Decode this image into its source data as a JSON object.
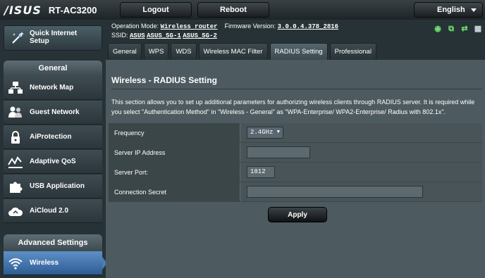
{
  "header": {
    "brand": "/ISUS",
    "model": "RT-AC3200",
    "logout_label": "Logout",
    "reboot_label": "Reboot",
    "language": "English"
  },
  "info": {
    "opmode_label": "Operation Mode:",
    "opmode_value": "Wireless router",
    "firmware_label": "Firmware Version:",
    "firmware_value": "3.0.0.4.378_2816",
    "ssid_label": "SSID:",
    "ssids": [
      "ASUS",
      "ASUS_5G-1",
      "ASUS_5G-2"
    ]
  },
  "sidebar": {
    "qis_label_line1": "Quick Internet",
    "qis_label_line2": "Setup",
    "general_title": "General",
    "general_items": [
      {
        "label": "Network Map",
        "icon": "network-map-icon"
      },
      {
        "label": "Guest Network",
        "icon": "guest-network-icon"
      },
      {
        "label": "AiProtection",
        "icon": "lock-icon"
      },
      {
        "label": "Adaptive QoS",
        "icon": "qos-icon"
      },
      {
        "label": "USB Application",
        "icon": "puzzle-icon"
      },
      {
        "label": "AiCloud 2.0",
        "icon": "cloud-icon"
      }
    ],
    "advanced_title": "Advanced Settings",
    "advanced_items": [
      {
        "label": "Wireless",
        "icon": "wifi-icon",
        "active": true
      }
    ]
  },
  "tabs": [
    {
      "label": "General"
    },
    {
      "label": "WPS"
    },
    {
      "label": "WDS"
    },
    {
      "label": "Wireless MAC Filter"
    },
    {
      "label": "RADIUS Setting",
      "active": true
    },
    {
      "label": "Professional"
    }
  ],
  "page": {
    "title": "Wireless - RADIUS Setting",
    "description": "This section allows you to set up additional parameters for authorizing wireless clients through RADIUS server. It is required while you select \"Authentication Method\" in \"Wireless - General\" as \"WPA-Enterprise/ WPA2-Enterprise/ Radius with 802.1x\".",
    "fields": {
      "frequency_label": "Frequency",
      "frequency_value": "2.4GHz",
      "server_ip_label": "Server IP Address",
      "server_ip_value": "",
      "server_port_label": "Server Port:",
      "server_port_value": "1812",
      "secret_label": "Connection Secret",
      "secret_value": ""
    },
    "apply_label": "Apply"
  },
  "colors": {
    "background": "#273236",
    "panel": "#4d5a5f",
    "active_menu": "#4a7db5",
    "status_green": "#6ee26e"
  }
}
